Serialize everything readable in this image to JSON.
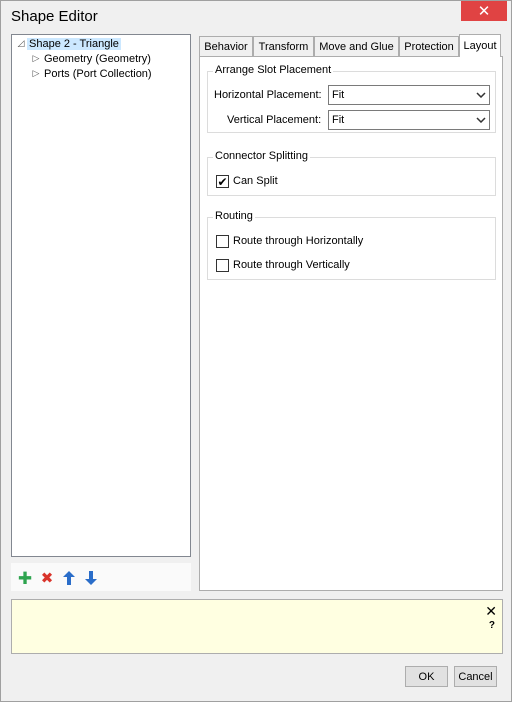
{
  "window": {
    "title": "Shape Editor",
    "close_glyph": "✕"
  },
  "tree": {
    "items": [
      {
        "label": "Shape 2 - Triangle",
        "toggle": "◿",
        "selected": true
      },
      {
        "label": "Geometry (Geometry)",
        "toggle": "▷"
      },
      {
        "label": "Ports (Port Collection)",
        "toggle": "▷"
      }
    ]
  },
  "toolbar": {
    "add": {
      "icon": "plus-icon",
      "glyph": "✚",
      "color": "#2ea44f"
    },
    "delete": {
      "icon": "delete-icon",
      "glyph": "✖",
      "color": "#d9342b"
    },
    "up": {
      "icon": "arrow-up-icon",
      "glyph": "🡑",
      "color": "#2a6dc9"
    },
    "down": {
      "icon": "arrow-down-icon",
      "glyph": "🡓",
      "color": "#2a6dc9"
    }
  },
  "tabs": [
    {
      "label": "Behavior"
    },
    {
      "label": "Transform"
    },
    {
      "label": "Move and Glue"
    },
    {
      "label": "Protection"
    },
    {
      "label": "Layout",
      "active": true
    }
  ],
  "layout": {
    "arrange": {
      "legend": "Arrange Slot Placement",
      "horizontal_label": "Horizontal Placement:",
      "horizontal_value": "Fit",
      "vertical_label": "Vertical Placement:",
      "vertical_value": "Fit"
    },
    "splitting": {
      "legend": "Connector Splitting",
      "can_split_label": "Can Split",
      "can_split_checked": true
    },
    "routing": {
      "legend": "Routing",
      "horizontally_label": "Route through Horizontally",
      "horizontally_checked": false,
      "vertically_label": "Route through Vertically",
      "vertically_checked": false
    }
  },
  "help": {
    "close_glyph": "✕",
    "question_glyph": "?"
  },
  "buttons": {
    "ok": "OK",
    "cancel": "Cancel"
  },
  "checkmark": "✔",
  "dropdown_arrow": "⌄"
}
